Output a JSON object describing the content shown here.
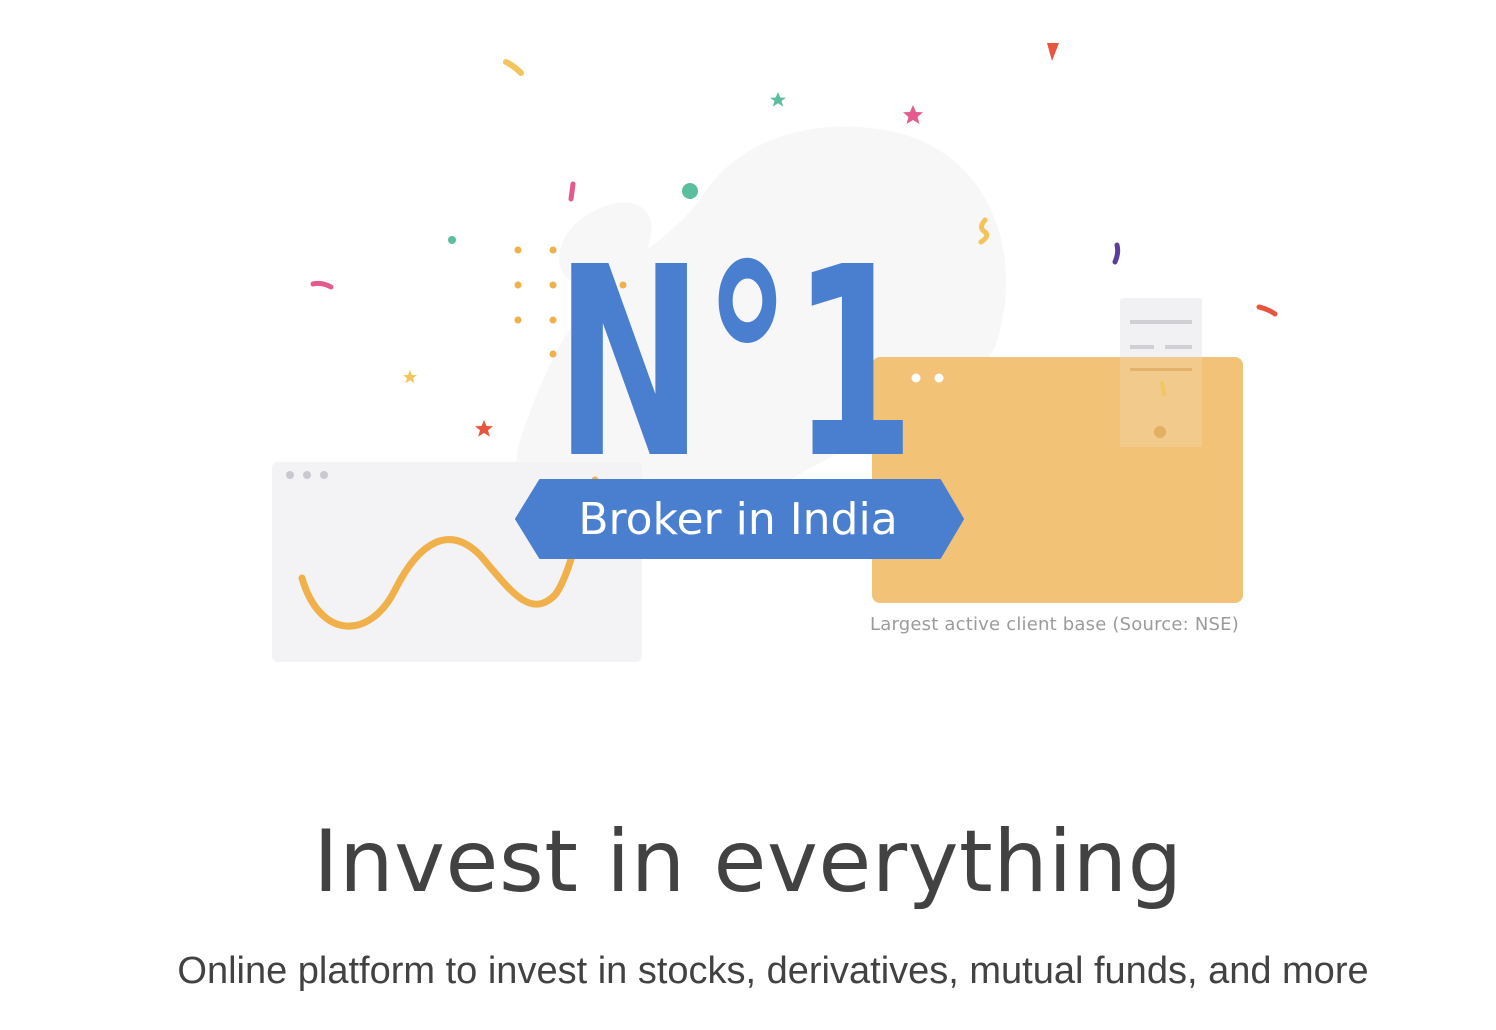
{
  "hero": {
    "rank_label": "N°1",
    "badge_label": "Broker in India",
    "caption": "Largest active client base (Source: NSE)"
  },
  "content": {
    "headline": "Invest in everything",
    "subheadline": "Online platform to invest in stocks, derivatives, mutual funds, and more"
  },
  "colors": {
    "brand_blue": "#4a7fd0",
    "card_orange": "#f2c276",
    "wave_orange": "#f0b04a",
    "card_grey": "#f3f3f6",
    "text_dark": "#424242",
    "caption_grey": "#9b9b9b"
  }
}
